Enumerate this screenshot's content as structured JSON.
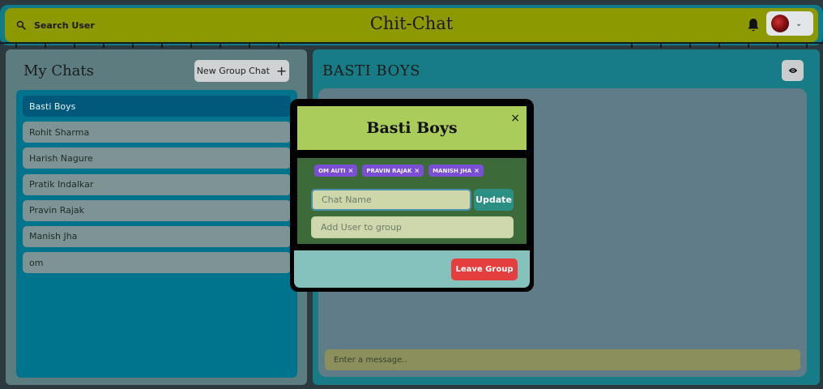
{
  "header": {
    "search_label": "Search User",
    "app_title": "Chit-Chat"
  },
  "sidebar": {
    "title": "My Chats",
    "new_group_label": "New Group Chat",
    "new_group_icon": "+",
    "chats": [
      {
        "label": "Basti Boys",
        "active": true
      },
      {
        "label": "Rohit Sharma"
      },
      {
        "label": "Harish Nagure"
      },
      {
        "label": "Pratik Indalkar"
      },
      {
        "label": "Pravin Rajak"
      },
      {
        "label": "Manish Jha"
      },
      {
        "label": "om"
      }
    ]
  },
  "chat": {
    "title": "BASTI BOYS",
    "message_placeholder": "Enter a message.."
  },
  "modal": {
    "title": "Basti Boys",
    "close_icon": "×",
    "members": [
      {
        "label": "om auti"
      },
      {
        "label": "pravin rajak"
      },
      {
        "label": "manish jha"
      }
    ],
    "chat_name_placeholder": "Chat Name",
    "update_label": "Update",
    "add_user_placeholder": "Add User to group",
    "leave_label": "Leave Group"
  },
  "colors": {
    "header_bg": "#8c9900",
    "header_border": "#117b8a",
    "chat_list_bg": "#00748d",
    "active_chat": "#00587a",
    "badge": "#7a4fd6",
    "update_btn": "#2b8f83",
    "leave_btn": "#e53e3e"
  },
  "icons": {
    "search": "search-icon",
    "bell": "bell-icon",
    "eye": "eye-icon",
    "chevron": "chevron-down-icon"
  }
}
